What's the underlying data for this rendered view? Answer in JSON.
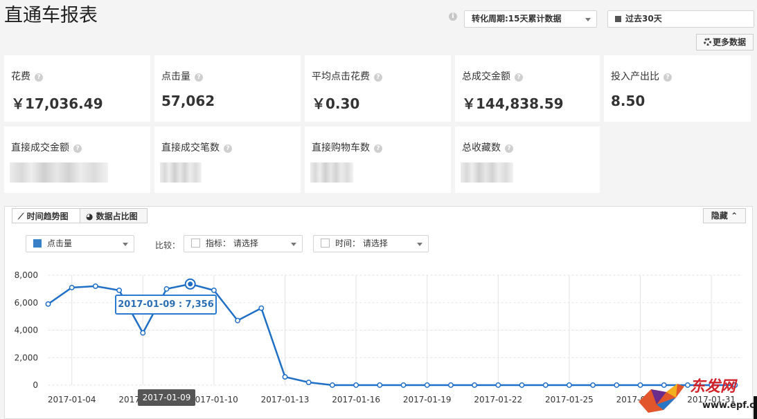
{
  "page": {
    "title": "直通车报表"
  },
  "toolbar": {
    "info_icon": "i",
    "period_select": "转化周期:15天累计数据",
    "date_range": "过去30天",
    "more_data_label": "更多数据"
  },
  "metrics": [
    {
      "label": "花费",
      "value": "￥17,036.49"
    },
    {
      "label": "点击量",
      "value": "57,062"
    },
    {
      "label": "平均点击花费",
      "value": "￥0.30"
    },
    {
      "label": "总成交金额",
      "value": "￥144,838.59"
    },
    {
      "label": "投入产出比",
      "value": "8.50"
    }
  ],
  "hidden_metrics": [
    {
      "label": "直接成交金额"
    },
    {
      "label": "直接成交笔数"
    },
    {
      "label": "直接购物车数"
    },
    {
      "label": "总收藏数"
    }
  ],
  "chart_panel": {
    "tabs": [
      {
        "label": "时间趋势图"
      },
      {
        "label": "数据占比图"
      }
    ],
    "hide_label": "隐藏",
    "metric_select": "点击量",
    "compare_label": "比较：",
    "indicator_select": "指标： 请选择",
    "time_select": "时间： 请选择",
    "tooltip": "2017-01-09 : 7,356",
    "hover_x_label": "2017-01-09"
  },
  "watermark": {
    "text": "东发网",
    "url": "www.epf.cn"
  },
  "colors": {
    "series": "#1f6fc6",
    "accent": "#2a7ad2",
    "swatch": "#3a80c9"
  },
  "chart_data": {
    "type": "line",
    "x": [
      "2017-01-03",
      "2017-01-04",
      "2017-01-05",
      "2017-01-06",
      "2017-01-07",
      "2017-01-08",
      "2017-01-09",
      "2017-01-10",
      "2017-01-11",
      "2017-01-12",
      "2017-01-13",
      "2017-01-14",
      "2017-01-15",
      "2017-01-16",
      "2017-01-17",
      "2017-01-18",
      "2017-01-19",
      "2017-01-20",
      "2017-01-21",
      "2017-01-22",
      "2017-01-23",
      "2017-01-24",
      "2017-01-25",
      "2017-01-26",
      "2017-01-27",
      "2017-01-28",
      "2017-01-29",
      "2017-01-30",
      "2017-01-31",
      "2017-02-01"
    ],
    "series": [
      {
        "name": "点击量",
        "values": [
          5900,
          7100,
          7200,
          6900,
          3800,
          7000,
          7356,
          6900,
          4700,
          5600,
          600,
          200,
          0,
          0,
          0,
          0,
          0,
          0,
          0,
          0,
          0,
          0,
          0,
          0,
          0,
          0,
          0,
          0,
          0,
          0
        ]
      }
    ],
    "x_tick_labels": [
      "2017-01-04",
      "2017-01-07",
      "2017-01-10",
      "2017-01-13",
      "2017-01-16",
      "2017-01-19",
      "2017-01-22",
      "2017-01-25",
      "2017-01-28",
      "2017-01-31"
    ],
    "y_ticks": [
      "0",
      "2,000",
      "4,000",
      "6,000",
      "8,000"
    ],
    "ylim": [
      0,
      8000
    ],
    "grid": true,
    "highlight_index": 6
  }
}
